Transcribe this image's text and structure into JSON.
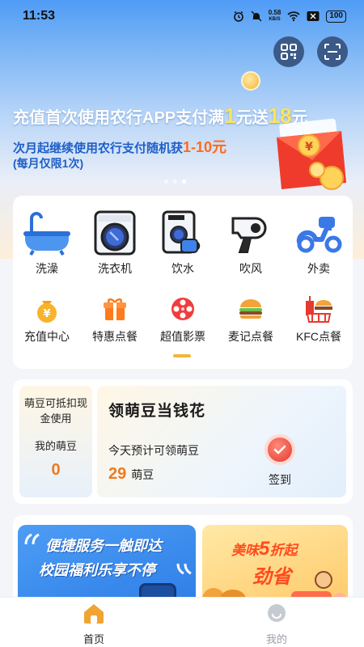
{
  "status_bar": {
    "time": "11:53",
    "net_speed_value": "0.58",
    "net_speed_unit": "KB/S",
    "battery": "100"
  },
  "banner": {
    "title_part1": "充值首次使用农行APP支付满",
    "title_hl1": "1",
    "title_part2": "元送",
    "title_hl2": "18",
    "title_part3": "元",
    "sub1_text": "次月起继续使用农行支付随机获",
    "sub1_hl": "1-10元",
    "sub2": "(每月仅限1次)"
  },
  "services": [
    {
      "label": "洗澡",
      "icon": "bathtub-icon"
    },
    {
      "label": "洗衣机",
      "icon": "washing-machine-icon"
    },
    {
      "label": "饮水",
      "icon": "water-dispenser-icon"
    },
    {
      "label": "吹风",
      "icon": "hair-dryer-icon"
    },
    {
      "label": "外卖",
      "icon": "scooter-icon"
    },
    {
      "label": "充值中心",
      "icon": "money-bag-icon"
    },
    {
      "label": "特惠点餐",
      "icon": "gift-box-icon"
    },
    {
      "label": "超值影票",
      "icon": "film-reel-icon"
    },
    {
      "label": "麦记点餐",
      "icon": "burger-icon"
    },
    {
      "label": "KFC点餐",
      "icon": "fast-food-icon"
    }
  ],
  "beans": {
    "left_desc": "萌豆可抵扣现金使用",
    "my_beans_label": "我的萌豆",
    "my_beans_value": "0",
    "title": "领萌豆当钱花",
    "estimate_label": "今天预计可领萌豆",
    "estimate_value": "29",
    "estimate_unit": "萌豆",
    "signin_label": "签到"
  },
  "promos": {
    "a_line1": "便捷服务一触即达",
    "a_line2": "校园福利乐享不停",
    "b_line1_hl": "美味",
    "b_line1_big": "5",
    "b_line1_rest": "折起",
    "b_line2": "劲省"
  },
  "nav": {
    "home": "首页",
    "mine": "我的",
    "active_color": "#f0a531",
    "inactive_color": "#9aa0a8"
  }
}
